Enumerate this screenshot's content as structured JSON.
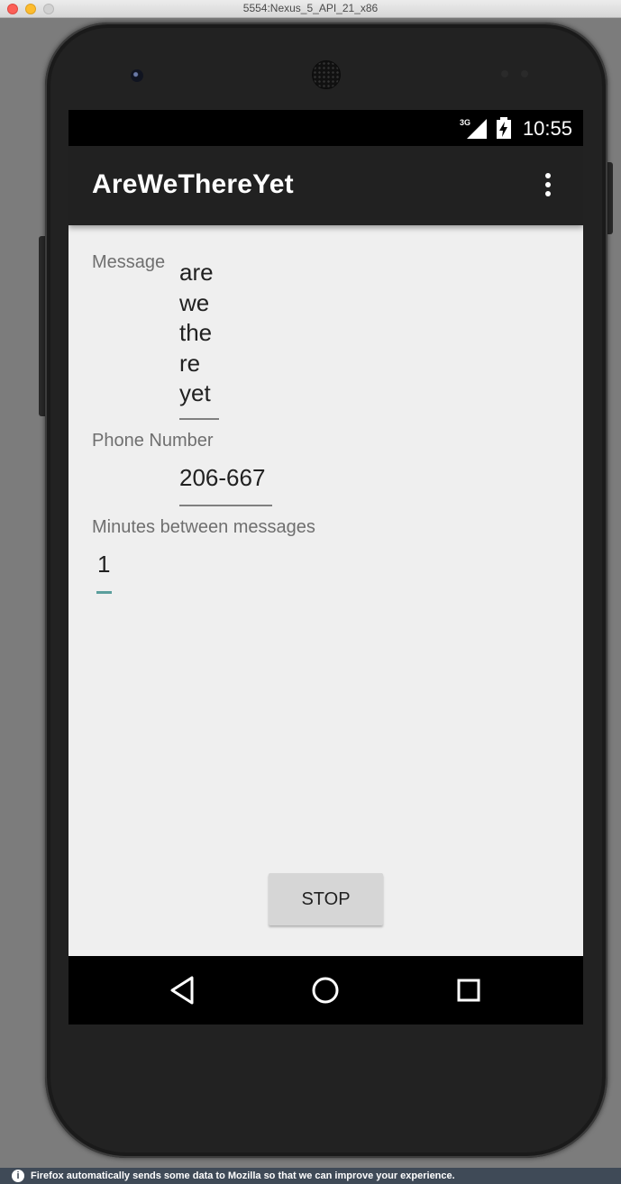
{
  "window": {
    "title": "5554:Nexus_5_API_21_x86"
  },
  "status_bar": {
    "time": "10:55",
    "network": "3G"
  },
  "app_bar": {
    "title": "AreWeThereYet",
    "overflow_icon": "more-vert-icon"
  },
  "form": {
    "message": {
      "label": "Message",
      "value_lines": [
        "are",
        "we",
        "the",
        "re",
        "yet"
      ]
    },
    "phone": {
      "label": "Phone Number",
      "value": "206-667"
    },
    "minutes": {
      "label": "Minutes between messages",
      "value": "1"
    }
  },
  "stop_button": {
    "label": "STOP"
  },
  "nav_bar": {
    "back": "back-icon",
    "home": "home-icon",
    "recents": "recents-icon"
  },
  "firefox_notice": {
    "text": "Firefox automatically sends some data to Mozilla so that we can improve your experience."
  },
  "colors": {
    "app_bar": "#212121",
    "background": "#efefef",
    "accent": "#5a9e9c"
  }
}
